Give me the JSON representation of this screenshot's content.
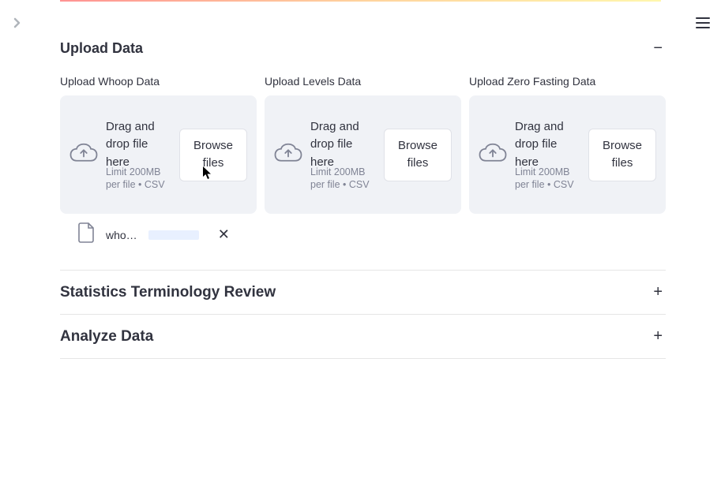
{
  "sections": {
    "upload": {
      "title": "Upload Data",
      "expanded": true,
      "collapse_symbol": "−",
      "uploaders": [
        {
          "label": "Upload Whoop Data",
          "instruction": "Drag and drop file here",
          "limit": "Limit 200MB per file • CSV",
          "browse": "Browse files"
        },
        {
          "label": "Upload Levels Data",
          "instruction": "Drag and drop file here",
          "limit": "Limit 200MB per file • CSV",
          "browse": "Browse files"
        },
        {
          "label": "Upload Zero Fasting Data",
          "instruction": "Drag and drop file here",
          "limit": "Limit 200MB per file • CSV",
          "browse": "Browse files"
        }
      ],
      "uploaded_file": {
        "name": "who…",
        "remove_symbol": "✕"
      }
    },
    "stats": {
      "title": "Statistics Terminology Review",
      "expand_symbol": "+"
    },
    "analyze": {
      "title": "Analyze Data",
      "expand_symbol": "+"
    }
  }
}
